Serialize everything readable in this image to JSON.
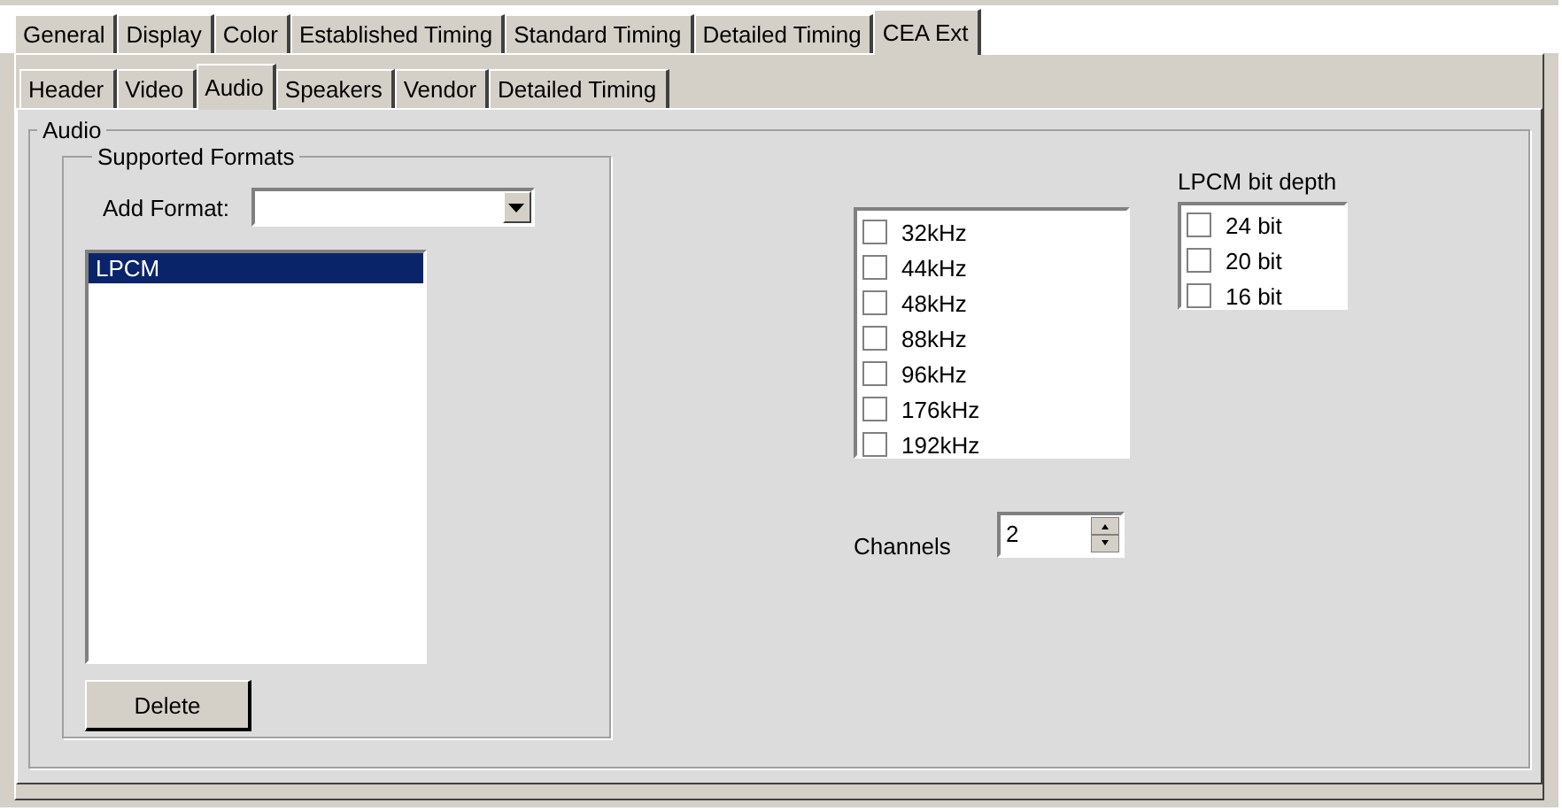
{
  "main_tabs": [
    {
      "label": "General",
      "selected": false
    },
    {
      "label": "Display",
      "selected": false
    },
    {
      "label": "Color",
      "selected": false
    },
    {
      "label": "Established Timing",
      "selected": false
    },
    {
      "label": "Standard Timing",
      "selected": false
    },
    {
      "label": "Detailed Timing",
      "selected": false
    },
    {
      "label": "CEA Ext",
      "selected": true
    }
  ],
  "sub_tabs": [
    {
      "label": "Header",
      "selected": false
    },
    {
      "label": "Video",
      "selected": false
    },
    {
      "label": "Audio",
      "selected": true
    },
    {
      "label": "Speakers",
      "selected": false
    },
    {
      "label": "Vendor",
      "selected": false
    },
    {
      "label": "Detailed Timing",
      "selected": false
    }
  ],
  "audio_group": {
    "title": "Audio",
    "supported_formats": {
      "title": "Supported Formats",
      "add_format_label": "Add Format:",
      "formats": [
        {
          "label": "LPCM",
          "selected": true
        }
      ],
      "delete_button": "Delete"
    },
    "sample_rates": [
      {
        "label": "32kHz",
        "checked": false
      },
      {
        "label": "44kHz",
        "checked": false
      },
      {
        "label": "48kHz",
        "checked": false
      },
      {
        "label": "88kHz",
        "checked": false
      },
      {
        "label": "96kHz",
        "checked": false
      },
      {
        "label": "176kHz",
        "checked": false
      },
      {
        "label": "192kHz",
        "checked": false
      }
    ],
    "bit_depth": {
      "title": "LPCM bit depth",
      "options": [
        {
          "label": "24 bit",
          "checked": false
        },
        {
          "label": "20 bit",
          "checked": false
        },
        {
          "label": "16 bit",
          "checked": false
        }
      ]
    },
    "channels": {
      "label": "Channels",
      "value": "2"
    }
  }
}
